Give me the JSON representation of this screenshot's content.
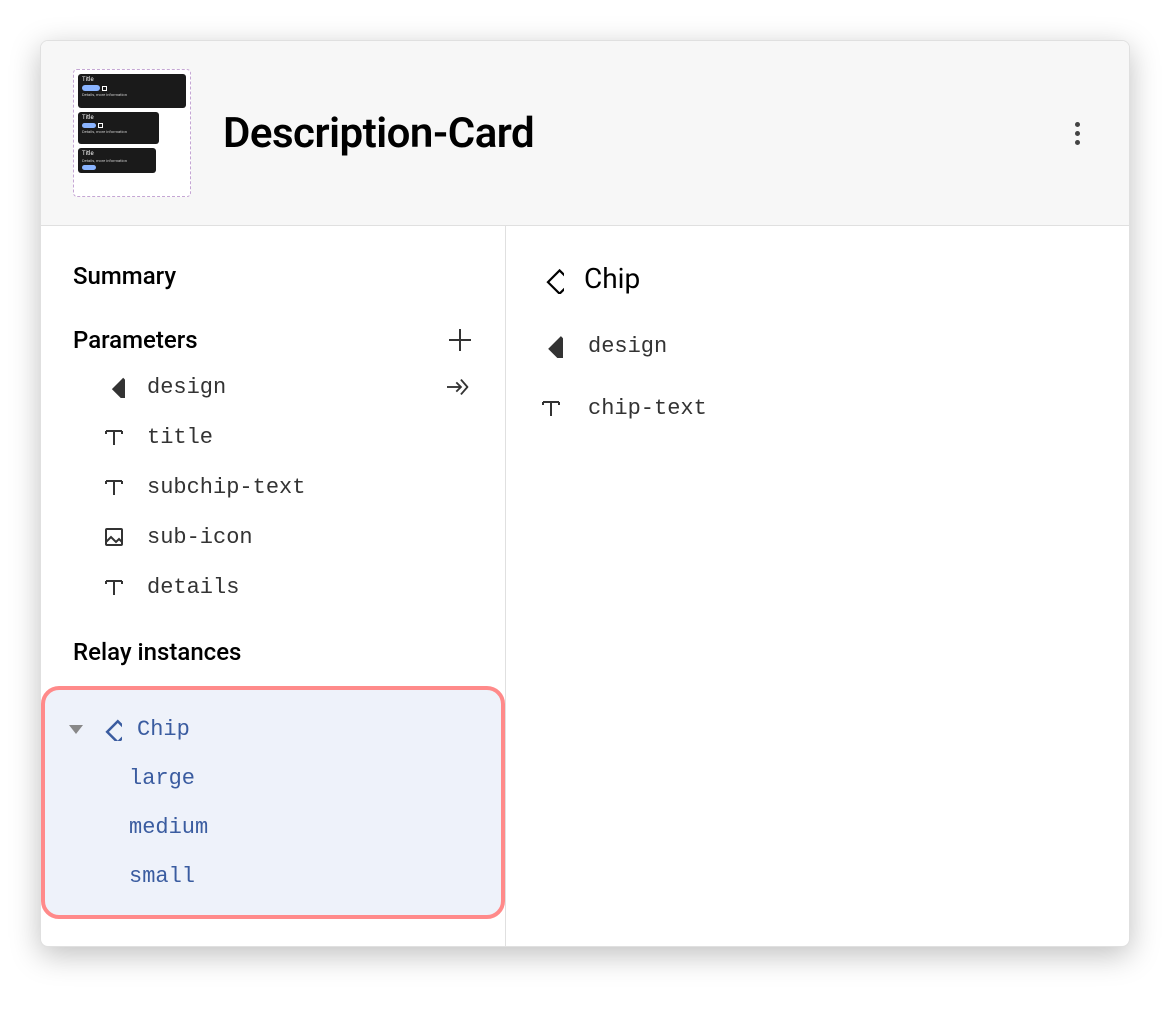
{
  "header": {
    "title": "Description-Card"
  },
  "left": {
    "summary_label": "Summary",
    "parameters_label": "Parameters",
    "parameters": [
      {
        "icon": "diamond-filled",
        "label": "design",
        "action": "arrow-into"
      },
      {
        "icon": "text",
        "label": "title"
      },
      {
        "icon": "text",
        "label": "subchip-text"
      },
      {
        "icon": "image",
        "label": "sub-icon"
      },
      {
        "icon": "text",
        "label": "details"
      }
    ],
    "instances_label": "Relay instances",
    "instances": {
      "root": {
        "label": "Chip",
        "expanded": true
      },
      "children": [
        "large",
        "medium",
        "small"
      ]
    }
  },
  "right": {
    "title": "Chip",
    "params": [
      {
        "icon": "diamond-filled",
        "label": "design"
      },
      {
        "icon": "text",
        "label": "chip-text"
      }
    ]
  }
}
